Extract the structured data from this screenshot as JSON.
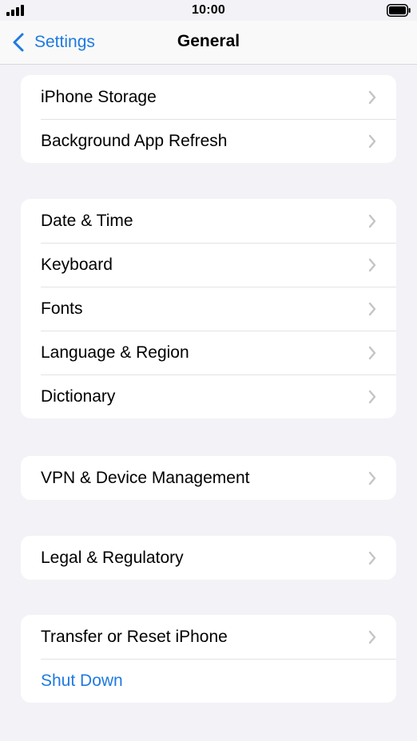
{
  "status_bar": {
    "time": "10:00",
    "signal_icon": "cellular-signal-icon",
    "battery_icon": "battery-full-icon"
  },
  "nav": {
    "back_label": "Settings",
    "title": "General",
    "accent_color": "#1f7ae0"
  },
  "groups": [
    {
      "items": [
        {
          "label": "iPhone Storage"
        },
        {
          "label": "Background App Refresh"
        }
      ]
    },
    {
      "items": [
        {
          "label": "Date & Time"
        },
        {
          "label": "Keyboard"
        },
        {
          "label": "Fonts"
        },
        {
          "label": "Language & Region"
        },
        {
          "label": "Dictionary"
        }
      ]
    },
    {
      "items": [
        {
          "label": "VPN & Device Management"
        }
      ]
    },
    {
      "items": [
        {
          "label": "Legal & Regulatory"
        }
      ]
    },
    {
      "items": [
        {
          "label": "Transfer or Reset iPhone"
        },
        {
          "label": "Shut Down"
        }
      ]
    }
  ]
}
